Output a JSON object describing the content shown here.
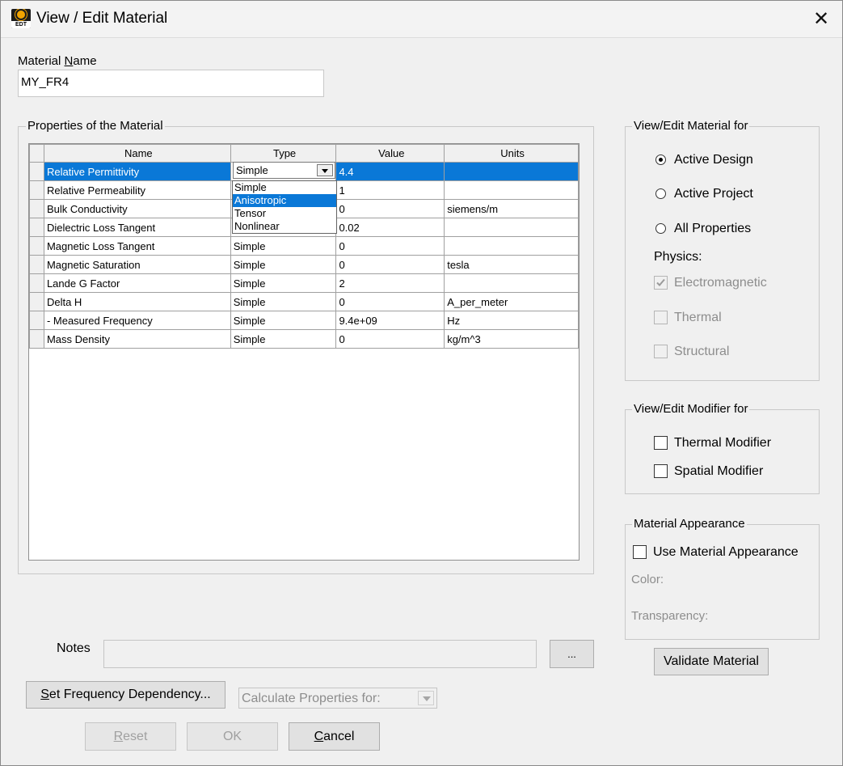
{
  "window": {
    "title": "View / Edit Material",
    "icon_text": "EDT",
    "close_glyph": "✕"
  },
  "material_name": {
    "label_prefix": "Material ",
    "label_accel": "N",
    "label_rest": "ame",
    "value": "MY_FR4"
  },
  "properties": {
    "group_title": "Properties of the Material",
    "columns": [
      "Name",
      "Type",
      "Value",
      "Units"
    ],
    "rows": [
      {
        "name": "Relative Permittivity",
        "type": "Simple",
        "value": "4.4",
        "units": ""
      },
      {
        "name": "Relative Permeability",
        "type": "",
        "value": "1",
        "units": ""
      },
      {
        "name": "Bulk Conductivity",
        "type": "",
        "value": "0",
        "units": "siemens/m"
      },
      {
        "name": "Dielectric Loss Tangent",
        "type": "",
        "value": "0.02",
        "units": ""
      },
      {
        "name": "Magnetic Loss Tangent",
        "type": "Simple",
        "value": "0",
        "units": ""
      },
      {
        "name": "Magnetic Saturation",
        "type": "Simple",
        "value": "0",
        "units": "tesla"
      },
      {
        "name": "Lande G Factor",
        "type": "Simple",
        "value": "2",
        "units": ""
      },
      {
        "name": "Delta H",
        "type": "Simple",
        "value": "0",
        "units": "A_per_meter"
      },
      {
        "name": "- Measured Frequency",
        "type": "Simple",
        "value": "9.4e+09",
        "units": "Hz"
      },
      {
        "name": "Mass Density",
        "type": "Simple",
        "value": "0",
        "units": "kg/m^3"
      }
    ],
    "type_combo_value": "Simple",
    "type_options": [
      "Simple",
      "Anisotropic",
      "Tensor",
      "Nonlinear"
    ],
    "type_highlighted": "Anisotropic"
  },
  "view_for": {
    "group_title": "View/Edit Material for",
    "options": [
      "Active Design",
      "Active Project",
      "All Properties"
    ],
    "selected": "Active Design",
    "physics_label": "Physics:",
    "physics": [
      {
        "label": "Electromagnetic",
        "checked": true
      },
      {
        "label": "Thermal",
        "checked": false
      },
      {
        "label": "Structural",
        "checked": false
      }
    ]
  },
  "modifier": {
    "group_title": "View/Edit Modifier for",
    "items": [
      {
        "label": "Thermal Modifier",
        "checked": false
      },
      {
        "label": "Spatial Modifier",
        "checked": false
      }
    ]
  },
  "appearance": {
    "group_title": "Material Appearance",
    "use_label": "Use Material Appearance",
    "color_label": "Color:",
    "transparency_label": "Transparency:"
  },
  "notes": {
    "label": "Notes",
    "value": "",
    "browse_label": "..."
  },
  "buttons": {
    "validate": "Validate Material",
    "freq_prefix": "",
    "freq_accel": "S",
    "freq_rest": "et Frequency Dependency...",
    "calc_placeholder": "Calculate Properties for:",
    "reset_accel": "R",
    "reset_rest": "eset",
    "ok": "OK",
    "cancel_accel": "C",
    "cancel_rest": "ancel"
  },
  "colors": {
    "selection": "#0a78d7",
    "dialog_bg": "#f0f0f0"
  }
}
